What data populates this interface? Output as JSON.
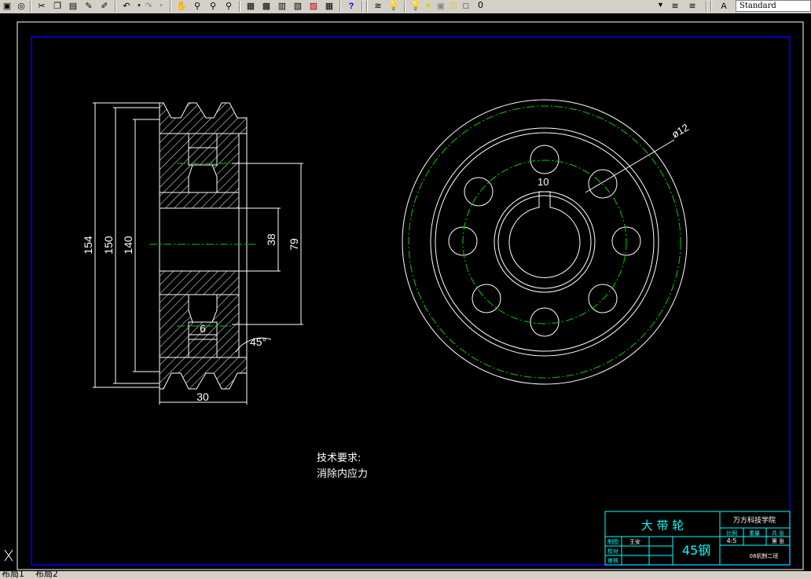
{
  "toolbar": {
    "layer_value": "0",
    "text_style_value": "Standard"
  },
  "drawing": {
    "dims": {
      "d154": "154",
      "d150": "150",
      "d140": "140",
      "d38": "38",
      "d79": "79",
      "d6": "6",
      "d30": "30",
      "angle": "45°",
      "hole_dia": "ø12",
      "keyway": "10"
    },
    "notes": {
      "title": "技术要求:",
      "line1": "消除内应力"
    },
    "title_block": {
      "part_name": "大 带 轮",
      "school": "万方科技学院",
      "scale_label": "比例",
      "qty_label": "重量",
      "sheet_label": "共 张",
      "scale_value": "4:5",
      "sheet_of": "第 张",
      "drawn_label": "制图",
      "drawer": "王安",
      "checked_label": "校对",
      "review_label": "审核",
      "material": "45钢",
      "class_name": "08机制二班"
    }
  },
  "tabs": {
    "tab1": "布局1",
    "tab2": "布局2"
  },
  "colors": {
    "background": "#000000",
    "geometry": "#ffffff",
    "centerline": "#00cc00",
    "title_block": "#00ffff",
    "border": "#0000ff"
  }
}
